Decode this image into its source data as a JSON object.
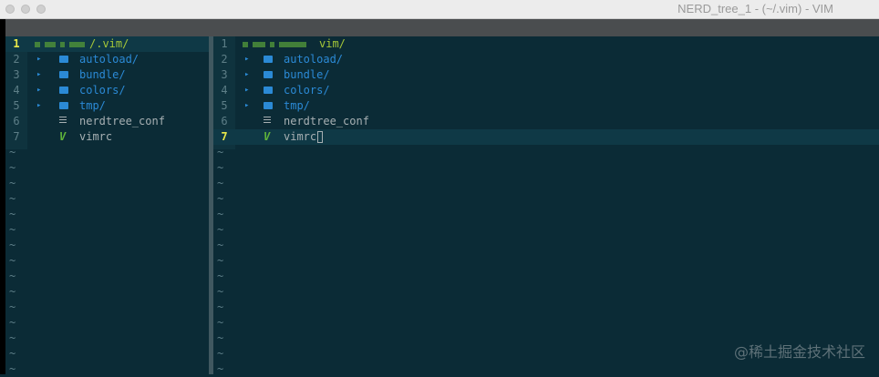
{
  "window": {
    "title": "NERD_tree_1 - (~/.vim) - VIM"
  },
  "left_pane": {
    "root": {
      "number": "1",
      "label": "/.vim/"
    },
    "entries": [
      {
        "number": "2",
        "label": "autoload/",
        "type": "folder",
        "icon": "folder-icon",
        "arrow": "▸"
      },
      {
        "number": "3",
        "label": "bundle/",
        "type": "folder",
        "icon": "folder-icon",
        "arrow": "▸"
      },
      {
        "number": "4",
        "label": "colors/",
        "type": "folder",
        "icon": "folder-icon",
        "arrow": "▸"
      },
      {
        "number": "5",
        "label": "tmp/",
        "type": "folder",
        "icon": "folder-icon",
        "arrow": "▸"
      },
      {
        "number": "6",
        "label": "nerdtree_conf",
        "type": "file",
        "icon": "text-file-icon"
      },
      {
        "number": "7",
        "label": "vimrc",
        "type": "vim",
        "icon": "vim-logo-icon",
        "glyph": "V"
      }
    ]
  },
  "right_pane": {
    "root": {
      "number": "1",
      "label": "vim/"
    },
    "entries": [
      {
        "number": "2",
        "label": "autoload/",
        "type": "folder",
        "arrow": "▸"
      },
      {
        "number": "3",
        "label": "bundle/",
        "type": "folder",
        "arrow": "▸"
      },
      {
        "number": "4",
        "label": "colors/",
        "type": "folder",
        "arrow": "▸"
      },
      {
        "number": "5",
        "label": "tmp/",
        "type": "folder",
        "arrow": "▸"
      },
      {
        "number": "6",
        "label": "nerdtree_conf",
        "type": "file"
      },
      {
        "number": "7",
        "label": "vimrc",
        "type": "vim",
        "glyph": "V"
      }
    ],
    "cursor_line": "7"
  },
  "tilde": "~",
  "watermark": "@稀土掘金技术社区",
  "colors": {
    "background": "#0b2b36",
    "folder": "#2b8ad6",
    "file": "#a7b0b3",
    "root": "#a6c838",
    "current_line_number": "#e8e84a",
    "vim_logo": "#5fb33a"
  }
}
